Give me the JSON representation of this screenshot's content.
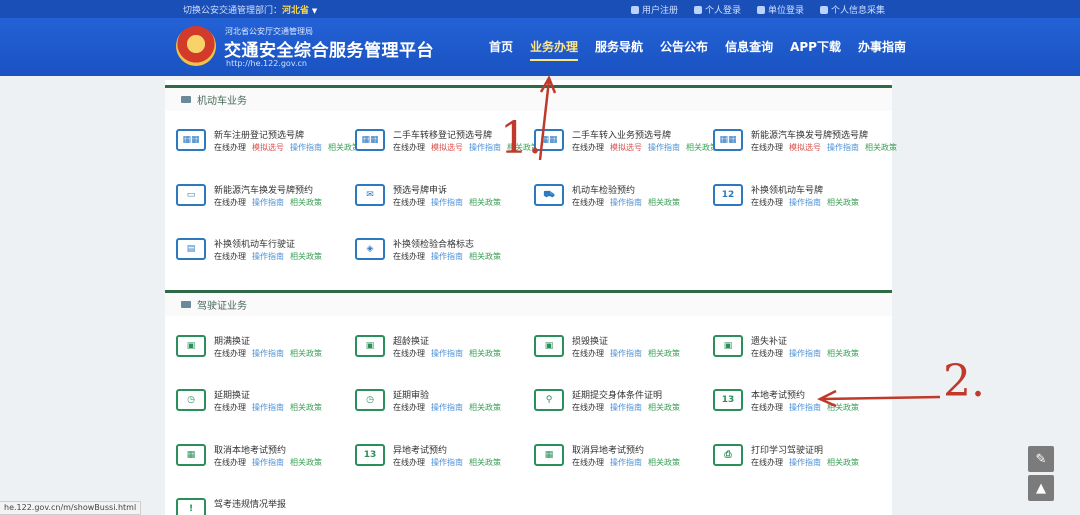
{
  "topbar": {
    "province_prefix": "切换公安交通管理部门：",
    "province": "河北省",
    "links": [
      {
        "label": "用户注册",
        "icon": "register-icon"
      },
      {
        "label": "个人登录",
        "icon": "user-icon"
      },
      {
        "label": "单位登录",
        "icon": "company-icon"
      },
      {
        "label": "个人信息采集",
        "icon": "info-icon"
      }
    ]
  },
  "header": {
    "org": "河北省公安厅交通管理局",
    "title": "交通安全综合服务管理平台",
    "url": "http://he.122.gov.cn",
    "nav": [
      "首页",
      "业务办理",
      "服务导航",
      "公告公布",
      "信息查询",
      "APP下载",
      "办事指南"
    ],
    "active_nav_index": 1
  },
  "sections": [
    {
      "title": "机动车业务",
      "items": [
        {
          "name": "新车注册登记预选号牌",
          "links": [
            "在线办理",
            "模拟选号",
            "操作指南",
            "相关政策"
          ],
          "icon": "plate-icon"
        },
        {
          "name": "二手车转移登记预选号牌",
          "links": [
            "在线办理",
            "模拟选号",
            "操作指南",
            "相关政策"
          ],
          "icon": "plate-icon"
        },
        {
          "name": "二手车转入业务预选号牌",
          "links": [
            "在线办理",
            "模拟选号",
            "操作指南",
            "相关政策"
          ],
          "icon": "plate-icon"
        },
        {
          "name": "新能源汽车换发号牌预选号牌",
          "links": [
            "在线办理",
            "模拟选号",
            "操作指南",
            "相关政策"
          ],
          "icon": "plate-icon"
        },
        {
          "name": "新能源汽车换发号牌预约",
          "links": [
            "在线办理",
            "操作指南",
            "相关政策"
          ],
          "icon": "ev-plate-icon"
        },
        {
          "name": "预选号牌申诉",
          "links": [
            "在线办理",
            "操作指南",
            "相关政策"
          ],
          "icon": "appeal-icon"
        },
        {
          "name": "机动车检验预约",
          "links": [
            "在线办理",
            "操作指南",
            "相关政策"
          ],
          "icon": "truck-icon"
        },
        {
          "name": "补换领机动车号牌",
          "links": [
            "在线办理",
            "操作指南",
            "相关政策"
          ],
          "icon": "plate-replace-icon"
        },
        {
          "name": "补换领机动车行驶证",
          "links": [
            "在线办理",
            "操作指南",
            "相关政策"
          ],
          "icon": "license-icon"
        },
        {
          "name": "补换领检验合格标志",
          "links": [
            "在线办理",
            "操作指南",
            "相关政策"
          ],
          "icon": "inspection-mark-icon"
        }
      ]
    },
    {
      "title": "驾驶证业务",
      "items": [
        {
          "name": "期满换证",
          "links": [
            "在线办理",
            "操作指南",
            "相关政策"
          ],
          "icon": "id-card-icon"
        },
        {
          "name": "超龄换证",
          "links": [
            "在线办理",
            "操作指南",
            "相关政策"
          ],
          "icon": "id-card-icon"
        },
        {
          "name": "损毁换证",
          "links": [
            "在线办理",
            "操作指南",
            "相关政策"
          ],
          "icon": "id-card-icon"
        },
        {
          "name": "遗失补证",
          "links": [
            "在线办理",
            "操作指南",
            "相关政策"
          ],
          "icon": "id-card-icon"
        },
        {
          "name": "延期换证",
          "links": [
            "在线办理",
            "操作指南",
            "相关政策"
          ],
          "icon": "id-card-clock-icon"
        },
        {
          "name": "延期审验",
          "links": [
            "在线办理",
            "操作指南",
            "相关政策"
          ],
          "icon": "id-card-clock-icon"
        },
        {
          "name": "延期提交身体条件证明",
          "links": [
            "在线办理",
            "操作指南",
            "相关政策"
          ],
          "icon": "person-doc-icon"
        },
        {
          "name": "本地考试预约",
          "links": [
            "在线办理",
            "操作指南",
            "相关政策"
          ],
          "icon": "calendar-icon"
        },
        {
          "name": "取消本地考试预约",
          "links": [
            "在线办理",
            "操作指南",
            "相关政策"
          ],
          "icon": "calendar-cancel-icon"
        },
        {
          "name": "异地考试预约",
          "links": [
            "在线办理",
            "操作指南",
            "相关政策"
          ],
          "icon": "calendar-icon"
        },
        {
          "name": "取消异地考试预约",
          "links": [
            "在线办理",
            "操作指南",
            "相关政策"
          ],
          "icon": "calendar-cancel-icon"
        },
        {
          "name": "打印学习驾驶证明",
          "links": [
            "在线办理",
            "操作指南",
            "相关政策"
          ],
          "icon": "printer-icon"
        },
        {
          "name": "驾考违规情况举报",
          "links": [],
          "icon": "report-icon"
        }
      ]
    }
  ],
  "annotations": [
    {
      "label": "1.",
      "color": "#c0392b"
    },
    {
      "label": "2.",
      "color": "#c0392b"
    }
  ],
  "side_buttons": [
    {
      "icon": "edit-icon"
    },
    {
      "icon": "back-to-top-icon"
    }
  ],
  "statusbar": "he.122.gov.cn/m/showBussi.html"
}
